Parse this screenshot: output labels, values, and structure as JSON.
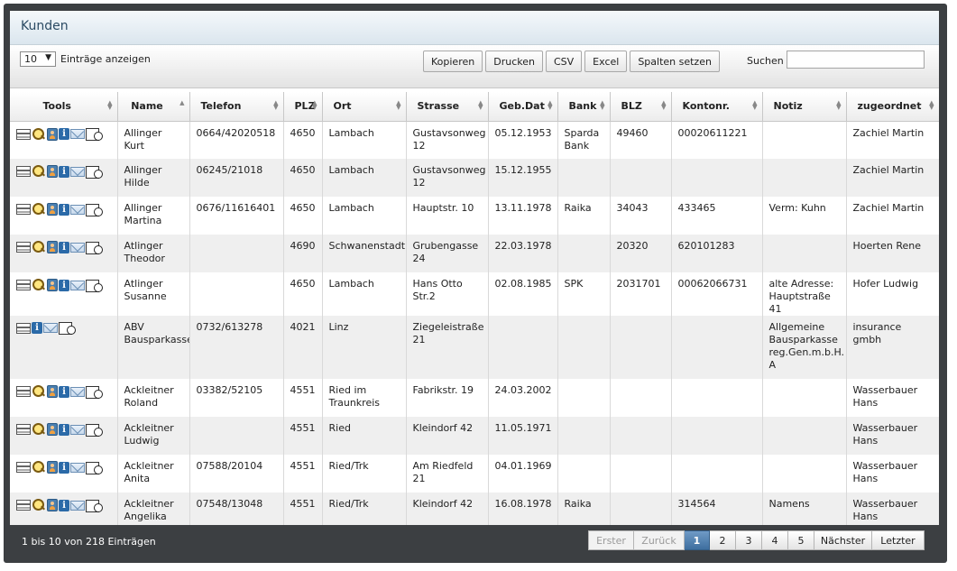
{
  "panel": {
    "title": "Kunden"
  },
  "controls": {
    "length_value": "10",
    "length_label": "Einträge anzeigen",
    "buttons": [
      "Kopieren",
      "Drucken",
      "CSV",
      "Excel",
      "Spalten setzen"
    ],
    "search_label": "Suchen",
    "search_value": ""
  },
  "table": {
    "columns": [
      "Tools",
      "Name",
      "Telefon",
      "PLZ",
      "Ort",
      "Strasse",
      "Geb.Dat",
      "Bank",
      "BLZ",
      "Kontonr.",
      "Notiz",
      "zugeordnet"
    ],
    "rows": [
      {
        "tools": "full",
        "name": "Allinger Kurt",
        "telefon": "0664/42020518",
        "plz": "4650",
        "ort": "Lambach",
        "strasse": "Gustavsonweg 12",
        "gebdat": "05.12.1953",
        "bank": "Sparda Bank",
        "blz": "49460",
        "kontonr": "00020611221",
        "notiz": "",
        "zugeordnet": "Zachiel Martin"
      },
      {
        "tools": "full",
        "name": "Allinger Hilde",
        "telefon": "06245/21018",
        "plz": "4650",
        "ort": "Lambach",
        "strasse": "Gustavsonweg 12",
        "gebdat": "15.12.1955",
        "bank": "",
        "blz": "",
        "kontonr": "",
        "notiz": "",
        "zugeordnet": "Zachiel Martin"
      },
      {
        "tools": "full",
        "name": "Allinger Martina",
        "telefon": "0676/11616401",
        "plz": "4650",
        "ort": "Lambach",
        "strasse": "Hauptstr. 10",
        "gebdat": "13.11.1978",
        "bank": "Raika",
        "blz": "34043",
        "kontonr": "433465",
        "notiz": "Verm: Kuhn",
        "zugeordnet": "Zachiel Martin"
      },
      {
        "tools": "full",
        "name": "Atlinger Theodor",
        "telefon": "",
        "plz": "4690",
        "ort": "Schwanenstadt",
        "strasse": "Grubengasse 24",
        "gebdat": "22.03.1978",
        "bank": "",
        "blz": "20320",
        "kontonr": "620101283",
        "notiz": "",
        "zugeordnet": "Hoerten Rene"
      },
      {
        "tools": "full",
        "name": "Atlinger Susanne",
        "telefon": "",
        "plz": "4650",
        "ort": "Lambach",
        "strasse": "Hans Otto Str.2",
        "gebdat": "02.08.1985",
        "bank": "SPK",
        "blz": "2031701",
        "kontonr": "00062066731",
        "notiz": "alte Adresse: Hauptstraße 41",
        "zugeordnet": "Hofer Ludwig"
      },
      {
        "tools": "short",
        "name": "ABV Bausparkasse",
        "telefon": "0732/613278",
        "plz": "4021",
        "ort": "Linz",
        "strasse": "Ziegeleistraße 21",
        "gebdat": "",
        "bank": "",
        "blz": "",
        "kontonr": "",
        "notiz": "Allgemeine Bausparkasse reg.Gen.m.b.H. A",
        "zugeordnet": "insurance gmbh"
      },
      {
        "tools": "full",
        "name": "Ackleitner Roland",
        "telefon": "03382/52105",
        "plz": "4551",
        "ort": "Ried im Traunkreis",
        "strasse": "Fabrikstr. 19",
        "gebdat": "24.03.2002",
        "bank": "",
        "blz": "",
        "kontonr": "",
        "notiz": "",
        "zugeordnet": "Wasserbauer Hans"
      },
      {
        "tools": "full",
        "name": "Ackleitner Ludwig",
        "telefon": "",
        "plz": "4551",
        "ort": "Ried",
        "strasse": "Kleindorf 42",
        "gebdat": "11.05.1971",
        "bank": "",
        "blz": "",
        "kontonr": "",
        "notiz": "",
        "zugeordnet": "Wasserbauer Hans"
      },
      {
        "tools": "full",
        "name": "Ackleitner Anita",
        "telefon": "07588/20104",
        "plz": "4551",
        "ort": "Ried/Trk",
        "strasse": "Am Riedfeld 21",
        "gebdat": "04.01.1969",
        "bank": "",
        "blz": "",
        "kontonr": "",
        "notiz": "",
        "zugeordnet": "Wasserbauer Hans"
      },
      {
        "tools": "full",
        "name": "Ackleitner Angelika",
        "telefon": "07548/13048",
        "plz": "4551",
        "ort": "Ried/Trk",
        "strasse": "Kleindorf 42",
        "gebdat": "16.08.1978",
        "bank": "Raika",
        "blz": "",
        "kontonr": "314564",
        "notiz": "Namens",
        "zugeordnet": "Wasserbauer Hans"
      }
    ]
  },
  "footer": {
    "info": "1 bis 10 von 218 Einträgen",
    "pages": [
      "Erster",
      "Zurück",
      "1",
      "2",
      "3",
      "4",
      "5",
      "Nächster",
      "Letzter"
    ],
    "active_page": "1"
  }
}
